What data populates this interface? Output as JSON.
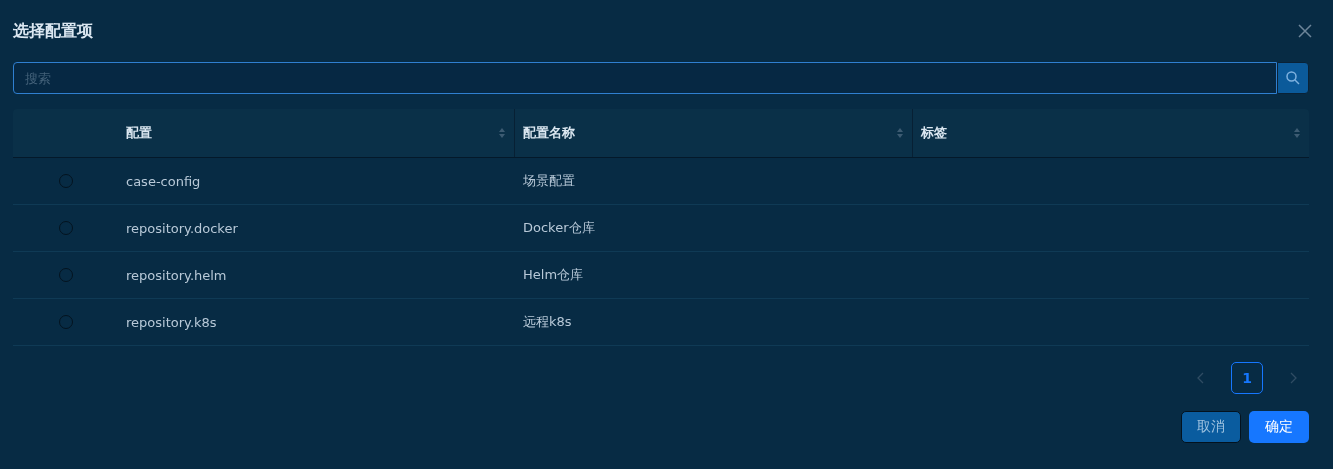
{
  "dialog": {
    "title": "选择配置项"
  },
  "search": {
    "placeholder": "搜索"
  },
  "table": {
    "columns": [
      "配置",
      "配置名称",
      "标签"
    ],
    "rows": [
      {
        "selected": false,
        "cells": [
          "case-config",
          "场景配置",
          ""
        ]
      },
      {
        "selected": false,
        "cells": [
          "repository.docker",
          "Docker仓库",
          ""
        ]
      },
      {
        "selected": false,
        "cells": [
          "repository.helm",
          "Helm仓库",
          ""
        ]
      },
      {
        "selected": false,
        "cells": [
          "repository.k8s",
          "远程k8s",
          ""
        ]
      }
    ]
  },
  "pagination": {
    "pages": [
      {
        "label": "1",
        "selected": true
      }
    ]
  },
  "buttons": [
    {
      "label": "取消",
      "kind": "secondary"
    },
    {
      "label": "确定",
      "kind": "primary"
    }
  ]
}
